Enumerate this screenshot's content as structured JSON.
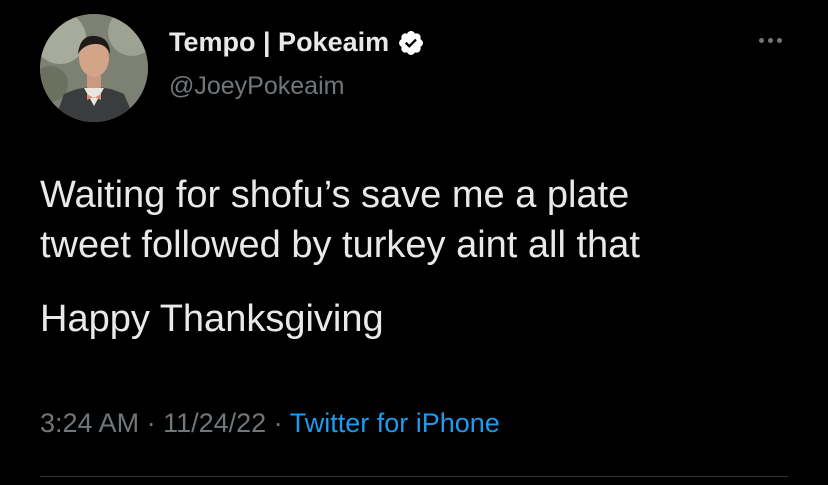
{
  "tweet": {
    "author": {
      "display_name": "Tempo | Pokeaim",
      "handle": "@JoeyPokeaim",
      "verified": true,
      "verified_icon": "verified-badge-icon"
    },
    "text_line1": "Waiting for shofu’s save me a plate",
    "text_line2": "tweet followed by turkey aint all that",
    "text_paragraph2": "Happy Thanksgiving",
    "time": "3:24 AM",
    "separator": " · ",
    "date": "11/24/22",
    "source": "Twitter for iPhone",
    "more_icon": "more-horizontal-icon"
  },
  "colors": {
    "background": "#000000",
    "primary_text": "#e7e9ea",
    "secondary_text": "#71767b",
    "link": "#1d9bf0",
    "verified_badge": "#ffffff",
    "divider": "#2f3336"
  }
}
